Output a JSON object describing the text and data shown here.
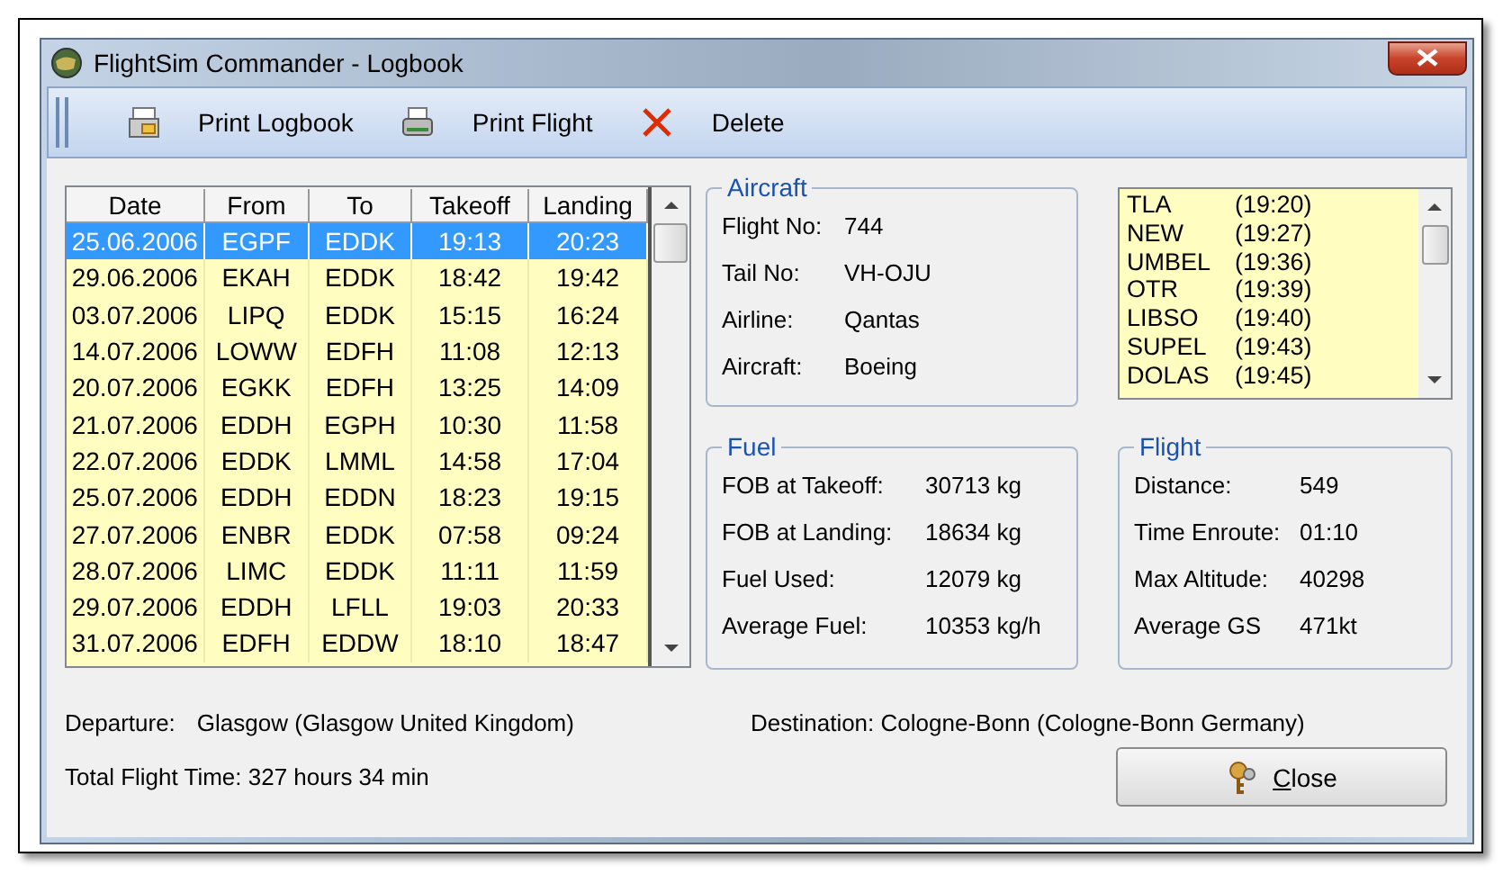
{
  "window": {
    "title": "FlightSim Commander - Logbook"
  },
  "toolbar": [
    {
      "kind": "print-logbook",
      "label": "Print Logbook"
    },
    {
      "kind": "print-flight",
      "label": "Print Flight"
    },
    {
      "kind": "delete",
      "label": "Delete"
    }
  ],
  "logbook": {
    "columns": [
      "Date",
      "From",
      "To",
      "Takeoff",
      "Landing"
    ],
    "rows": [
      {
        "selected": true,
        "cells": [
          "25.06.2006",
          "EGPF",
          "EDDK",
          "19:13",
          "20:23"
        ]
      },
      {
        "selected": false,
        "cells": [
          "29.06.2006",
          "EKAH",
          "EDDK",
          "18:42",
          "19:42"
        ]
      },
      {
        "selected": false,
        "cells": [
          "03.07.2006",
          "LIPQ",
          "EDDK",
          "15:15",
          "16:24"
        ]
      },
      {
        "selected": false,
        "cells": [
          "14.07.2006",
          "LOWW",
          "EDFH",
          "11:08",
          "12:13"
        ]
      },
      {
        "selected": false,
        "cells": [
          "20.07.2006",
          "EGKK",
          "EDFH",
          "13:25",
          "14:09"
        ]
      },
      {
        "selected": false,
        "cells": [
          "21.07.2006",
          "EDDH",
          "EGPH",
          "10:30",
          "11:58"
        ]
      },
      {
        "selected": false,
        "cells": [
          "22.07.2006",
          "EDDK",
          "LMML",
          "14:58",
          "17:04"
        ]
      },
      {
        "selected": false,
        "cells": [
          "25.07.2006",
          "EDDH",
          "EDDN",
          "18:23",
          "19:15"
        ]
      },
      {
        "selected": false,
        "cells": [
          "27.07.2006",
          "ENBR",
          "EDDK",
          "07:58",
          "09:24"
        ]
      },
      {
        "selected": false,
        "cells": [
          "28.07.2006",
          "LIMC",
          "EDDK",
          "11:11",
          "11:59"
        ]
      },
      {
        "selected": false,
        "cells": [
          "29.07.2006",
          "EDDH",
          "LFLL",
          "19:03",
          "20:33"
        ]
      },
      {
        "selected": false,
        "cells": [
          "31.07.2006",
          "EDFH",
          "EDDW",
          "18:10",
          "18:47"
        ]
      }
    ]
  },
  "aircraft": {
    "title": "Aircraft",
    "fields": [
      {
        "label": "Flight No:",
        "value": "744"
      },
      {
        "label": "Tail No:",
        "value": "VH-OJU"
      },
      {
        "label": "Airline:",
        "value": "Qantas"
      },
      {
        "label": "Aircraft:",
        "value": "Boeing"
      }
    ]
  },
  "waypoints": [
    {
      "name": "TLA",
      "time": "(19:20)"
    },
    {
      "name": "NEW",
      "time": "(19:27)"
    },
    {
      "name": "UMBEL",
      "time": "(19:36)"
    },
    {
      "name": "OTR",
      "time": "(19:39)"
    },
    {
      "name": "LIBSO",
      "time": "(19:40)"
    },
    {
      "name": "SUPEL",
      "time": "(19:43)"
    },
    {
      "name": "DOLAS",
      "time": "(19:45)"
    }
  ],
  "fuel": {
    "title": "Fuel",
    "fields": [
      {
        "label": "FOB at Takeoff:",
        "value": "30713 kg"
      },
      {
        "label": "FOB at Landing:",
        "value": "18634 kg"
      },
      {
        "label": "Fuel Used:",
        "value": "12079 kg"
      },
      {
        "label": "Average Fuel:",
        "value": "10353 kg/h"
      }
    ]
  },
  "flight": {
    "title": "Flight",
    "fields": [
      {
        "label": "Distance:",
        "value": "549"
      },
      {
        "label": "Time Enroute:",
        "value": "01:10"
      },
      {
        "label": "Max Altitude:",
        "value": "40298"
      },
      {
        "label": "Average GS",
        "value": "471kt"
      }
    ]
  },
  "departure": {
    "label": "Departure:",
    "value": "Glasgow (Glasgow United Kingdom)"
  },
  "destination": {
    "label": "Destination:",
    "value": "Cologne-Bonn (Cologne-Bonn Germany)"
  },
  "total_flight_time": "Total Flight Time: 327 hours 34 min",
  "close_button": "Close"
}
